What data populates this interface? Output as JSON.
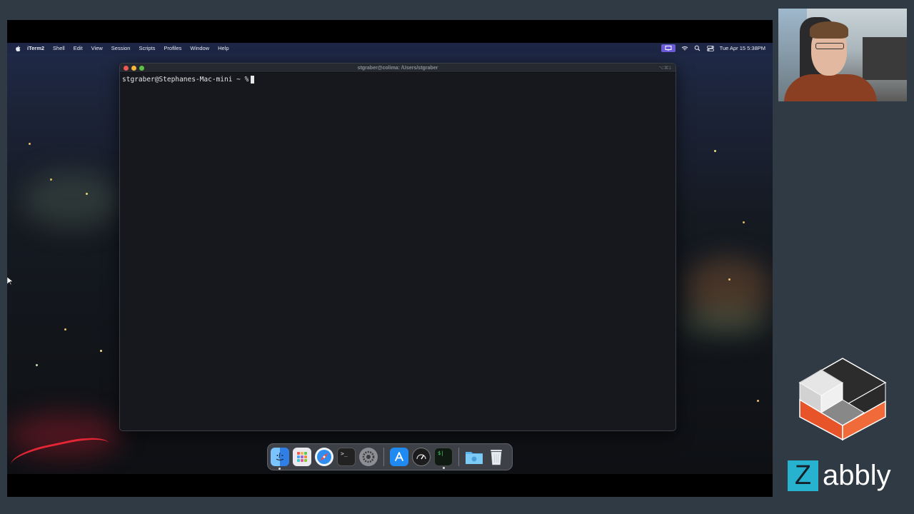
{
  "menubar": {
    "app_name": "iTerm2",
    "items": [
      "Shell",
      "Edit",
      "View",
      "Session",
      "Scripts",
      "Profiles",
      "Window",
      "Help"
    ],
    "clock": "Tue Apr 15  5:38PM",
    "icons": [
      "apple-icon",
      "screen-share-icon",
      "wifi-icon",
      "search-icon",
      "control-center-icon"
    ]
  },
  "terminal": {
    "title": "stgraber@colima: /Users/stgraber",
    "shortcut": "⌥⌘1",
    "prompt": "stgraber@Stephanes-Mac-mini ~ %"
  },
  "dock": {
    "apps": [
      "finder-icon",
      "launchpad-icon",
      "safari-icon",
      "terminal-icon",
      "system-settings-icon",
      "app-store-icon",
      "activity-monitor-icon",
      "iterm-icon",
      "downloads-folder-icon",
      "trash-icon"
    ],
    "colors": {
      "finder": "#3b8ef0",
      "safari": "#2f8ff0",
      "app_store": "#1f8af2"
    }
  },
  "branding": {
    "letter": "Z",
    "name": "abbly",
    "colors": {
      "accent": "#27b3cf",
      "cube_orange": "#e8542a",
      "cube_dark": "#2c2c2c",
      "cube_light": "#e6e6e6"
    }
  }
}
